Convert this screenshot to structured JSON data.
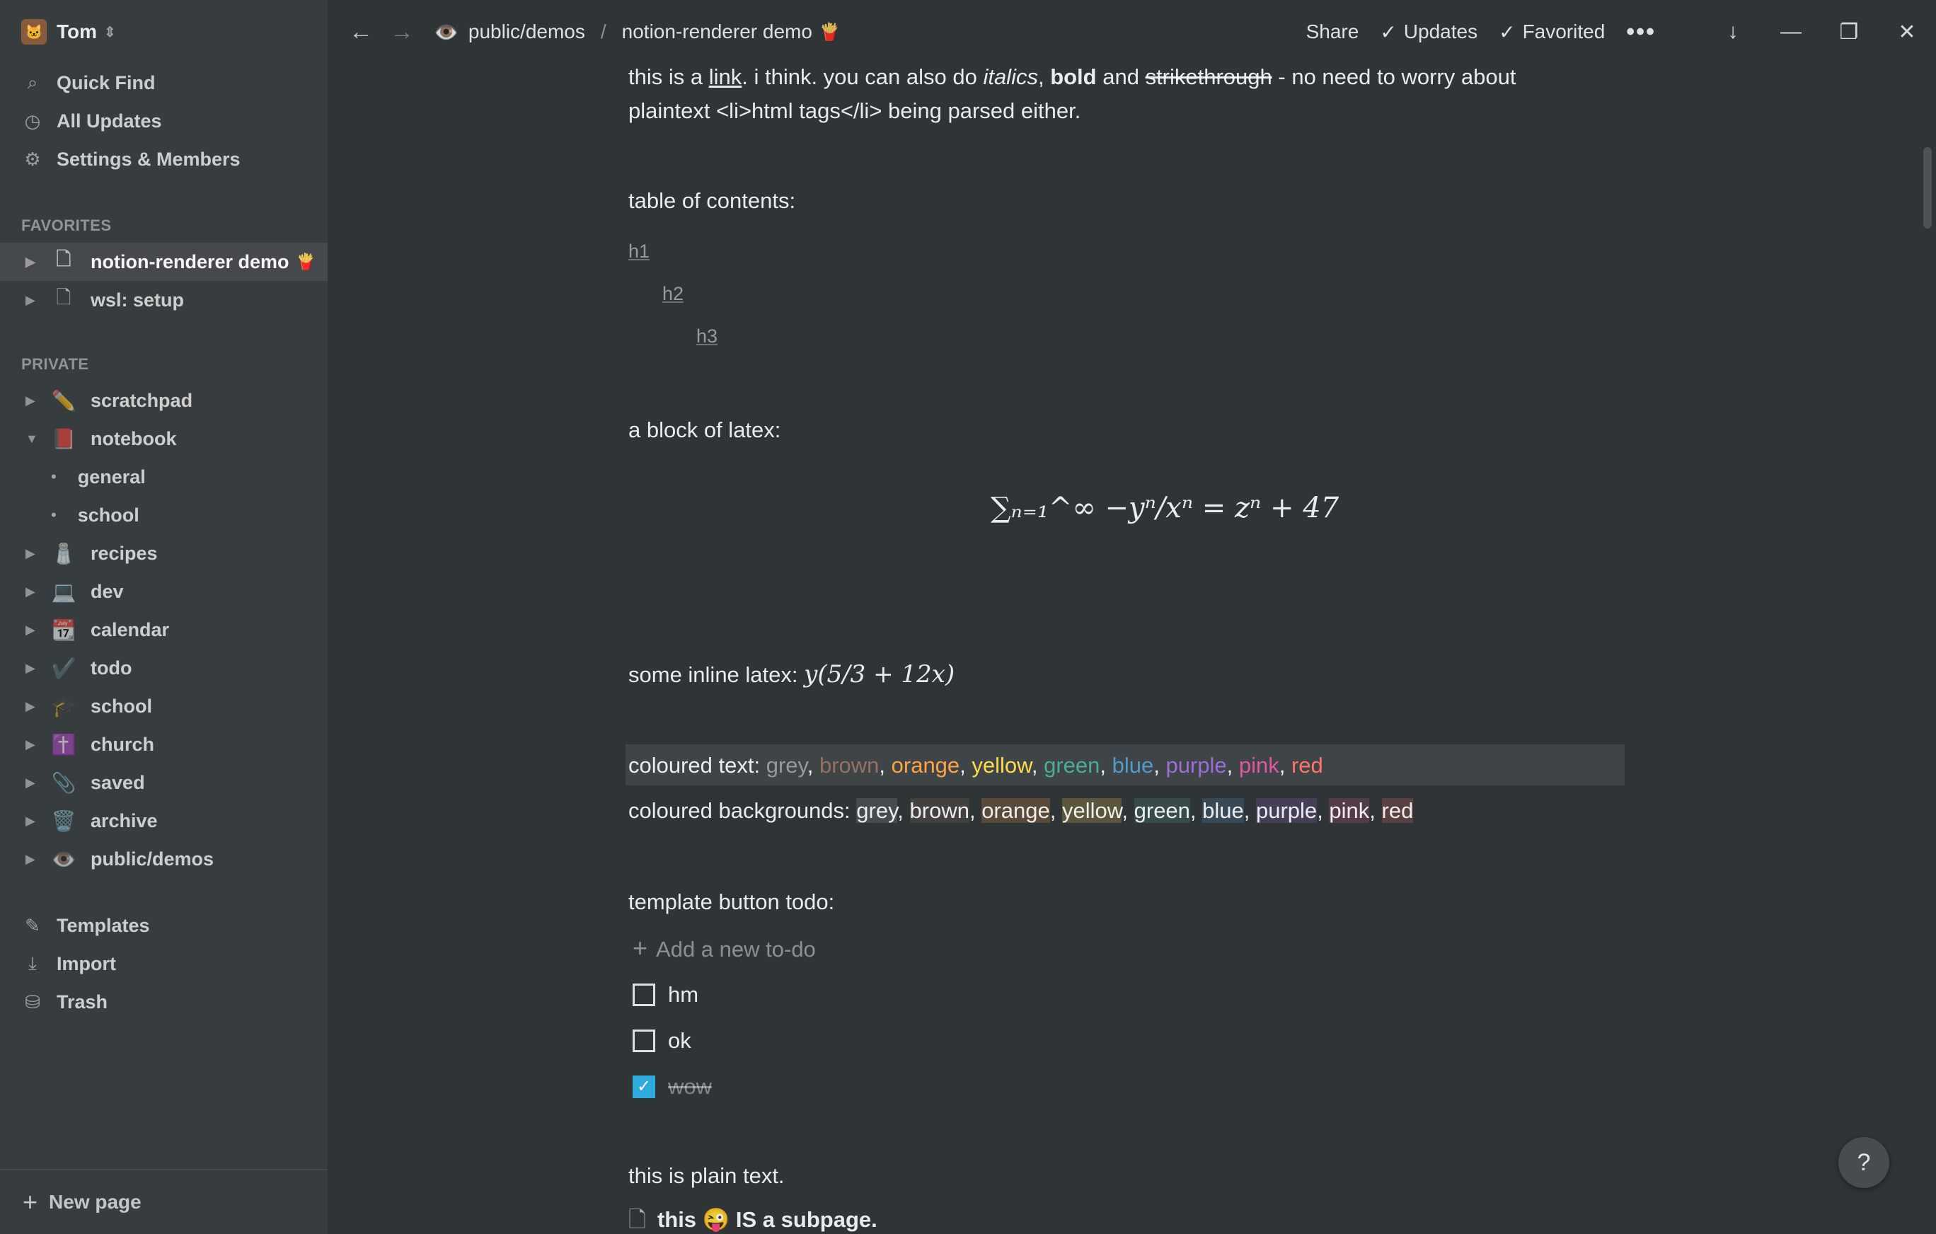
{
  "workspace": {
    "name": "Tom",
    "avatar": "🐱"
  },
  "sidebar": {
    "nav": [
      {
        "icon": "search-icon",
        "glyph": "⌕",
        "label": "Quick Find"
      },
      {
        "icon": "clock-icon",
        "glyph": "◷",
        "label": "All Updates"
      },
      {
        "icon": "gear-icon",
        "glyph": "⚙",
        "label": "Settings & Members"
      }
    ],
    "favorites_heading": "FAVORITES",
    "favorites": [
      {
        "label": "notion-renderer demo",
        "emoji": "🍟",
        "active": true
      },
      {
        "label": "wsl: setup",
        "active": false
      }
    ],
    "private_heading": "PRIVATE",
    "private": [
      {
        "emoji": "✏️",
        "label": "scratchpad"
      },
      {
        "emoji": "📕",
        "label": "notebook",
        "expanded": true
      },
      {
        "label": "general",
        "child": true
      },
      {
        "label": "school",
        "child": true
      },
      {
        "emoji": "🧂",
        "label": "recipes"
      },
      {
        "emoji": "💻",
        "label": "dev"
      },
      {
        "emoji": "📆",
        "label": "calendar"
      },
      {
        "emoji": "✔️",
        "label": "todo"
      },
      {
        "emoji": "🎓",
        "label": "school"
      },
      {
        "emoji": "✝️",
        "label": "church"
      },
      {
        "emoji": "📎",
        "label": "saved"
      },
      {
        "emoji": "🗑️",
        "label": "archive"
      },
      {
        "emoji": "👁️",
        "label": "public/demos"
      }
    ],
    "tools": [
      {
        "icon": "templates-icon",
        "glyph": "✎",
        "label": "Templates"
      },
      {
        "icon": "import-icon",
        "glyph": "⤓",
        "label": "Import"
      },
      {
        "icon": "trash-icon",
        "glyph": "🗑",
        "label": "Trash"
      }
    ],
    "new_page": "New page"
  },
  "topbar": {
    "crumb_parent_emoji": "👁️",
    "crumb_parent": "public/demos",
    "crumb_separator": "/",
    "crumb_current": "notion-renderer demo",
    "crumb_current_emoji": "🍟",
    "share": "Share",
    "updates": "Updates",
    "favorited": "Favorited",
    "more": "•••"
  },
  "content": {
    "intro_1a": "this is a ",
    "intro_link": "link",
    "intro_1b": ". i think. you can also do ",
    "intro_italic": "italics",
    "intro_1c": ", ",
    "intro_bold": "bold",
    "intro_1d": " and ",
    "intro_strike": "strikethrough",
    "intro_1e": " - no need to worry about",
    "intro_2": "plaintext <li>html tags</li> being parsed either.",
    "toc_heading": "table of contents:",
    "toc": [
      "h1",
      "h2",
      "h3"
    ],
    "latex_heading": "a block of latex:",
    "latex_block": "∑ₙ₌₁^∞ −yⁿ/xⁿ = zⁿ + 47",
    "inline_latex_label": "some inline latex: ",
    "inline_latex": "y(5/3 + 12x)",
    "coloured_text_label": "coloured text: ",
    "coloured_bg_label": "coloured backgrounds: ",
    "colours": [
      "grey",
      "brown",
      "orange",
      "yellow",
      "green",
      "blue",
      "purple",
      "pink",
      "red"
    ],
    "template_heading": "template button todo:",
    "add_todo": "Add a new to-do",
    "todos": [
      {
        "label": "hm",
        "checked": false
      },
      {
        "label": "ok",
        "checked": false
      },
      {
        "label": "wow",
        "checked": true
      }
    ],
    "plain": "this is plain text.",
    "subpage_a": "this ",
    "subpage_emoji": "😜",
    "subpage_b": " IS a subpage."
  },
  "help": "?"
}
